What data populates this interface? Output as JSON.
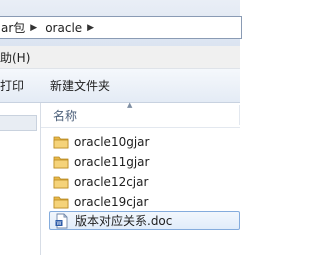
{
  "address_bar": {
    "crumbs": [
      "ar包",
      "oracle"
    ]
  },
  "menubar": {
    "help": "助(H)"
  },
  "toolbar": {
    "print": "打印",
    "new_folder": "新建文件夹"
  },
  "file_list": {
    "column_name": "名称",
    "items": [
      {
        "name": "oracle10gjar",
        "icon": "folder-icon"
      },
      {
        "name": "oracle11gjar",
        "icon": "folder-icon"
      },
      {
        "name": "oracle12cjar",
        "icon": "folder-icon"
      },
      {
        "name": "oracle19cjar",
        "icon": "folder-icon"
      },
      {
        "name": "版本对应关系.doc",
        "icon": "doc-file-icon",
        "selected": true
      }
    ]
  },
  "colors": {
    "folder": "#e8b84a",
    "selection_border": "#84acdd"
  }
}
